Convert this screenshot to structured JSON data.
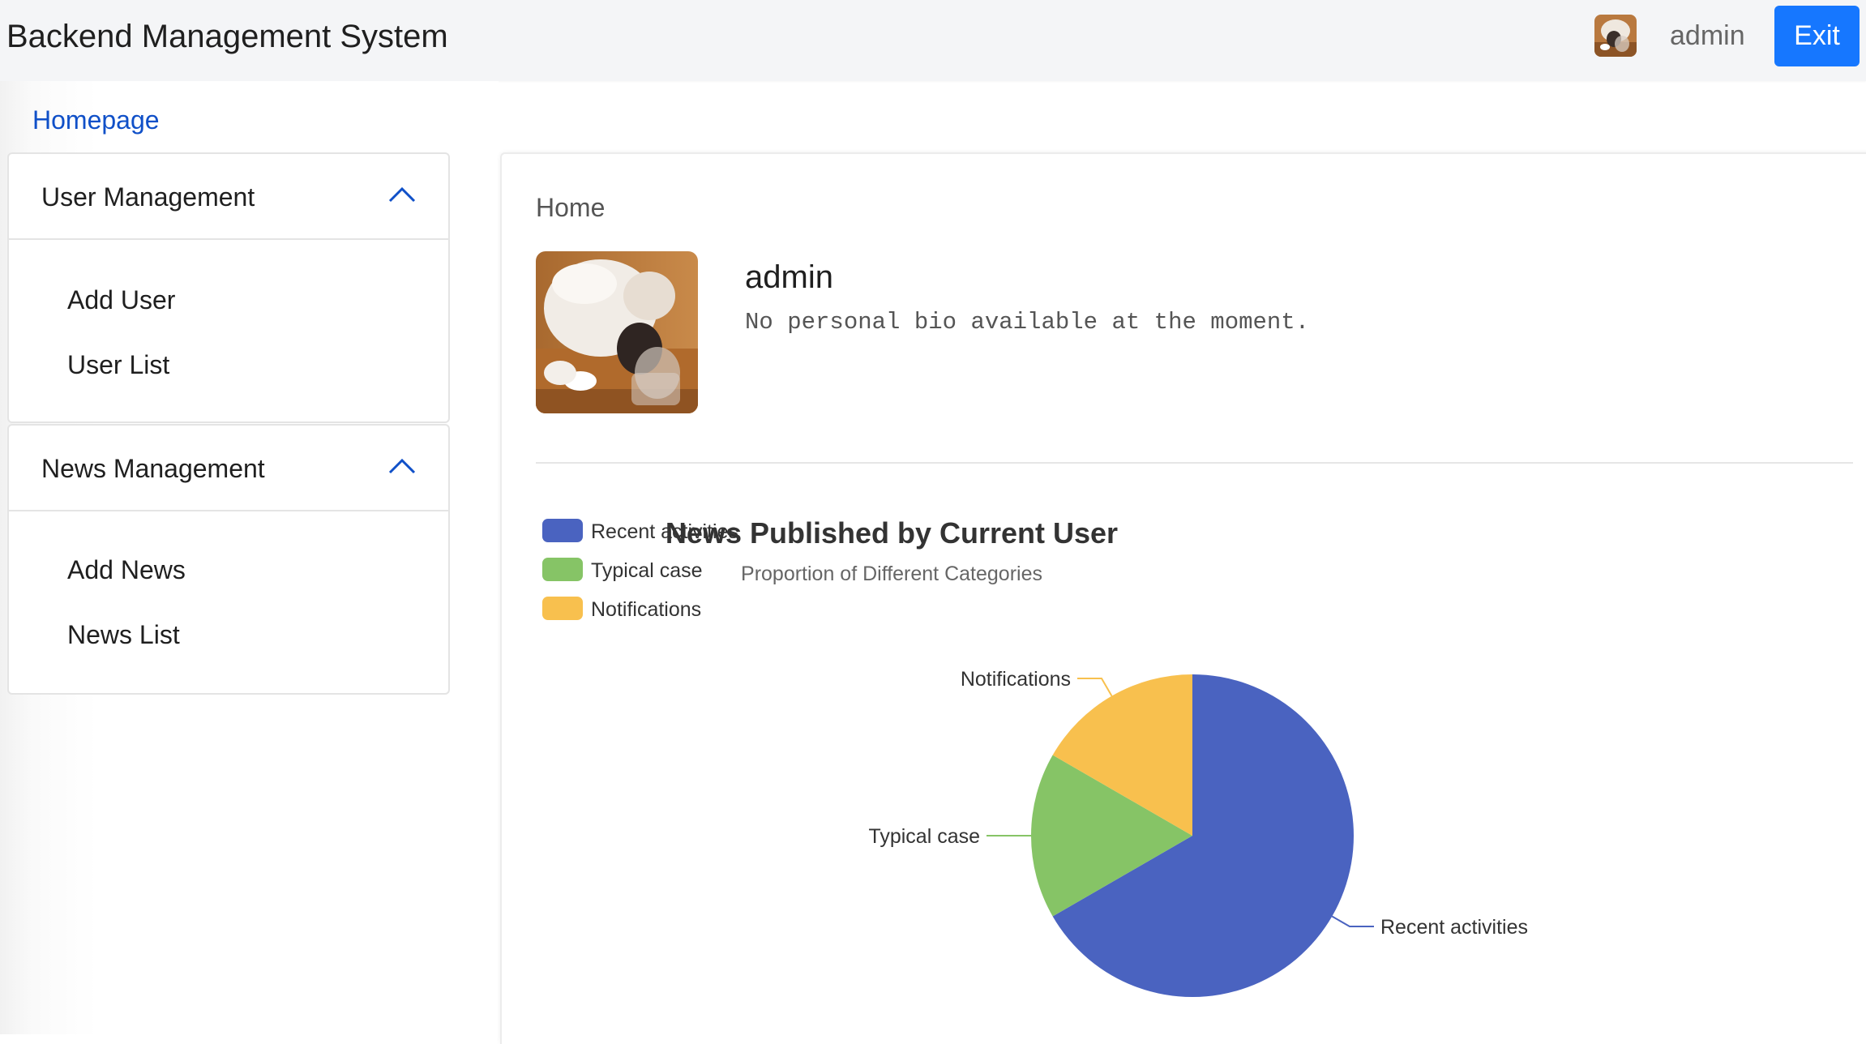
{
  "header": {
    "title": "Backend Management System",
    "username": "admin",
    "exit_label": "Exit"
  },
  "nav": {
    "homepage_label": "Homepage",
    "panels": [
      {
        "title": "User Management",
        "items": [
          "Add User",
          "User List"
        ]
      },
      {
        "title": "News Management",
        "items": [
          "Add News",
          "News List"
        ]
      }
    ]
  },
  "main": {
    "card_title": "Home",
    "profile": {
      "name": "admin",
      "bio": "No personal bio available at the moment."
    }
  },
  "colors": {
    "accent": "#1677ff",
    "link": "#1050c8",
    "recent": "#4a63c0",
    "typical": "#86c466",
    "notifications": "#f8c04e"
  },
  "icons": {
    "panel_toggle": "chevron-up-icon",
    "avatar": "cat-photo"
  },
  "chart_data": {
    "type": "pie",
    "title": "News Published by Current User",
    "subtitle": "Proportion of Different Categories",
    "legend_position": "top-left",
    "slices": [
      {
        "name": "Recent activities",
        "value": 4,
        "color": "#4a63c0"
      },
      {
        "name": "Typical case",
        "value": 1,
        "color": "#86c466"
      },
      {
        "name": "Notifications",
        "value": 1,
        "color": "#f8c04e"
      }
    ]
  }
}
